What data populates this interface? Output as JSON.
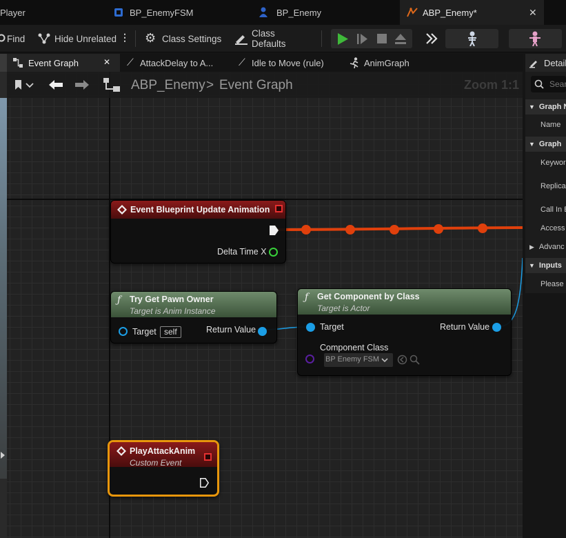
{
  "file_tabs": [
    {
      "label": "Player",
      "icon": "blueprint-icon"
    },
    {
      "label": "BP_EnemyFSM",
      "icon": "blueprint-component-icon"
    },
    {
      "label": "BP_Enemy",
      "icon": "pawn-icon"
    },
    {
      "label": "ABP_Enemy*",
      "icon": "anim-blueprint-icon",
      "active": true
    }
  ],
  "toolbar": {
    "find": "Find",
    "hide_unrelated": "Hide Unrelated",
    "class_settings": "Class Settings",
    "class_defaults": "Class Defaults"
  },
  "graph_tabs": [
    {
      "label": "Event Graph",
      "active": true
    },
    {
      "label": "AttackDelay to A..."
    },
    {
      "label": "Idle to Move (rule)"
    },
    {
      "label": "AnimGraph"
    }
  ],
  "breadcrumb": {
    "root": "ABP_Enemy",
    "separator": ">",
    "current": "Event Graph"
  },
  "zoom": "Zoom 1:1",
  "nodes": {
    "update_anim": {
      "title": "Event Blueprint Update Animation",
      "pin_delta": "Delta Time X"
    },
    "pawn_owner": {
      "title": "Try Get Pawn Owner",
      "subtitle": "Target is Anim Instance",
      "pin_target": "Target",
      "target_value": "self",
      "pin_return": "Return Value"
    },
    "get_component": {
      "title": "Get Component by Class",
      "subtitle": "Target is Actor",
      "pin_target": "Target",
      "pin_return": "Return Value",
      "pin_class": "Component Class",
      "class_value": "BP Enemy FSM"
    },
    "play_attack": {
      "title": "PlayAttackAnim",
      "subtitle": "Custom Event"
    }
  },
  "details": {
    "title": "Detail",
    "search_placeholder": "Sear",
    "rows": [
      {
        "label": "Graph N",
        "section": true
      },
      {
        "label": "Name"
      },
      {
        "label": "Graph",
        "section": true
      },
      {
        "label": "Keywor"
      },
      {
        "label": "Replica"
      },
      {
        "label": "Call In E"
      },
      {
        "label": "Access"
      },
      {
        "label": "Advanc",
        "section": false,
        "collapsible": true
      },
      {
        "label": "Inputs",
        "section": true
      },
      {
        "label": "Please"
      }
    ]
  },
  "colors": {
    "exec_wire": "#e0400c",
    "object_pin": "#1b9ee6",
    "class_pin": "#5a1fa0",
    "float_pin": "#38d13a",
    "selection": "#e8960c",
    "play_green": "#3fb93a"
  }
}
